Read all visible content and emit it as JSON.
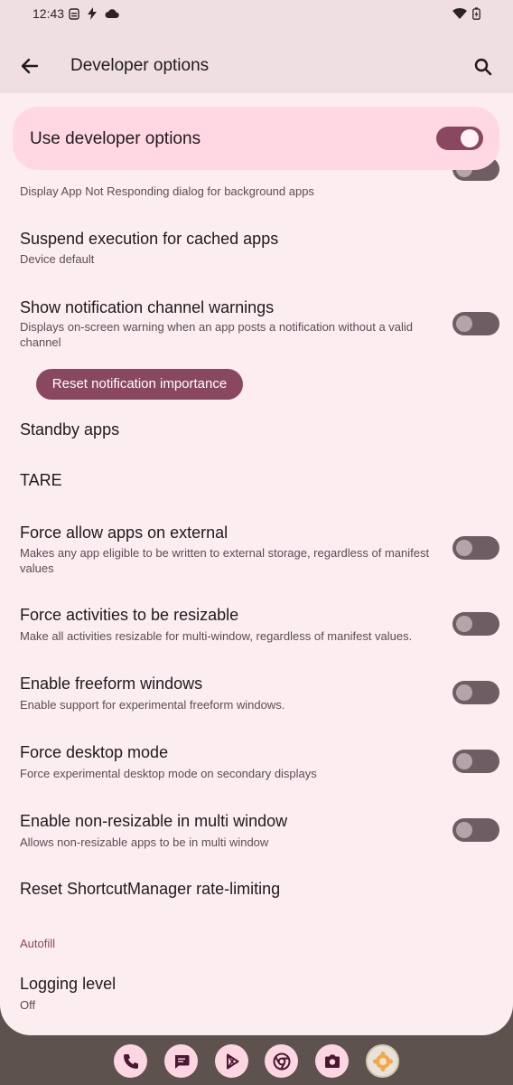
{
  "status": {
    "time": "12:43"
  },
  "header": {
    "title": "Developer options"
  },
  "master": {
    "label": "Use developer options",
    "on": true
  },
  "rows": {
    "bg_anr": {
      "subtitle": "Display App Not Responding dialog for background apps"
    },
    "suspend": {
      "title": "Suspend execution for cached apps",
      "subtitle": "Device default"
    },
    "notif": {
      "title": "Show notification channel warnings",
      "subtitle": "Displays on-screen warning when an app posts a notification without a valid channel"
    },
    "reset_btn": {
      "label": "Reset notification importance"
    },
    "standby": {
      "title": "Standby apps"
    },
    "tare": {
      "title": "TARE"
    },
    "force_external": {
      "title": "Force allow apps on external",
      "subtitle": "Makes any app eligible to be written to external storage, regardless of manifest values"
    },
    "force_resizable": {
      "title": "Force activities to be resizable",
      "subtitle": "Make all activities resizable for multi-window, regardless of manifest values."
    },
    "freeform": {
      "title": "Enable freeform windows",
      "subtitle": "Enable support for experimental freeform windows."
    },
    "desktop": {
      "title": "Force desktop mode",
      "subtitle": "Force experimental desktop mode on secondary displays"
    },
    "nonresizable": {
      "title": "Enable non-resizable in multi window",
      "subtitle": "Allows non-resizable apps to be in multi window"
    },
    "shortcut": {
      "title": "Reset ShortcutManager rate-limiting"
    },
    "autofill_section": {
      "label": "Autofill"
    },
    "logging": {
      "title": "Logging level",
      "subtitle": "Off"
    }
  },
  "dock": {
    "apps": [
      "phone-icon",
      "messages-icon",
      "play-store-icon",
      "chrome-icon",
      "camera-icon",
      "settings-icon"
    ]
  },
  "colors": {
    "accent": "#8a4860",
    "surface": "#fcedf1",
    "header": "#efdfe3",
    "master_bg": "#ffd8e4"
  }
}
